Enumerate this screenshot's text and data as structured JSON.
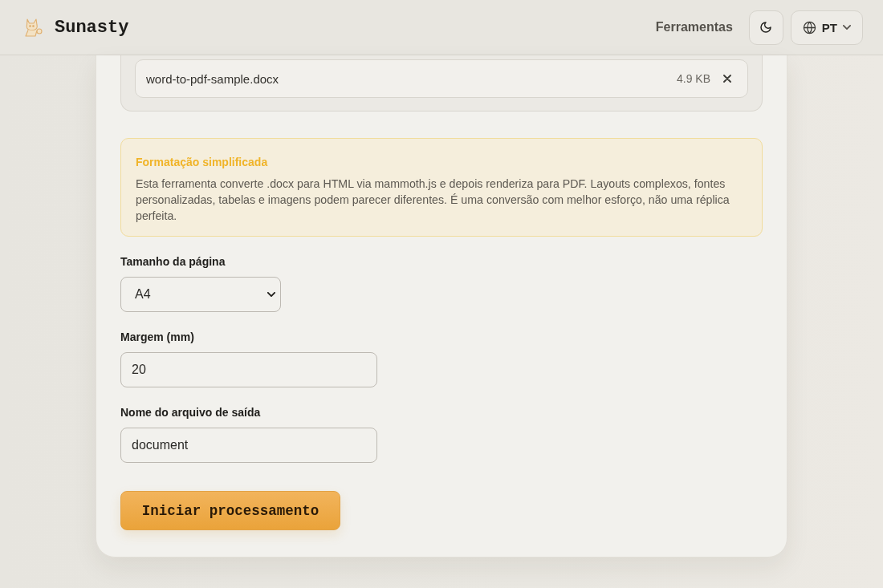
{
  "header": {
    "brand": "Sunasty",
    "nav_link": "Ferramentas",
    "language": "PT"
  },
  "file_list": [
    {
      "name": "word-to-pdf-sample.docx",
      "size": "4.9 KB"
    }
  ],
  "notice": {
    "title": "Formatação simplificada",
    "text": "Esta ferramenta converte .docx para HTML via mammoth.js e depois renderiza para PDF. Layouts complexos, fontes personalizadas, tabelas e imagens podem parecer diferentes. É uma conversão com melhor esforço, não uma réplica perfeita."
  },
  "fields": [
    {
      "kind": "select",
      "label": "Tamanho da página",
      "value": "A4"
    },
    {
      "kind": "input",
      "label": "Margem (mm)",
      "value": "20"
    },
    {
      "kind": "input",
      "label": "Nome do arquivo de saída",
      "value": "document"
    }
  ],
  "submit_button": "Iniciar processamento"
}
